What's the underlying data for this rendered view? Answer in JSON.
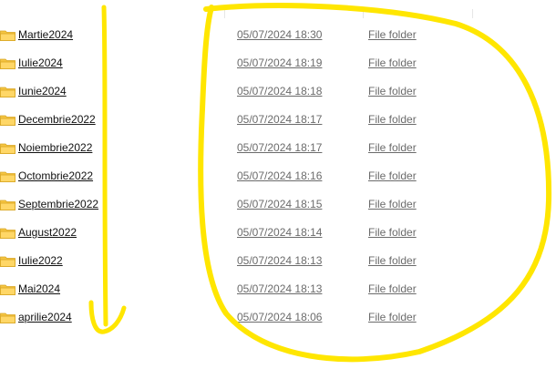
{
  "annotation_color": "#ffe600",
  "folder_color": "#f5c542",
  "rows": [
    {
      "name": "Martie2024",
      "date": "05/07/2024 18:30",
      "type": "File folder",
      "icon": "folder-icon"
    },
    {
      "name": "Iulie2024",
      "date": "05/07/2024 18:19",
      "type": "File folder",
      "icon": "folder-icon"
    },
    {
      "name": "Iunie2024",
      "date": "05/07/2024 18:18",
      "type": "File folder",
      "icon": "folder-icon"
    },
    {
      "name": "Decembrie2022",
      "date": "05/07/2024 18:17",
      "type": "File folder",
      "icon": "folder-icon"
    },
    {
      "name": "Noiembrie2022",
      "date": "05/07/2024 18:17",
      "type": "File folder",
      "icon": "folder-icon"
    },
    {
      "name": "Octombrie2022",
      "date": "05/07/2024 18:16",
      "type": "File folder",
      "icon": "folder-icon"
    },
    {
      "name": "Septembrie2022",
      "date": "05/07/2024 18:15",
      "type": "File folder",
      "icon": "folder-icon"
    },
    {
      "name": "August2022",
      "date": "05/07/2024 18:14",
      "type": "File folder",
      "icon": "folder-icon"
    },
    {
      "name": "Iulie2022",
      "date": "05/07/2024 18:13",
      "type": "File folder",
      "icon": "folder-icon"
    },
    {
      "name": "Mai2024",
      "date": "05/07/2024 18:13",
      "type": "File folder",
      "icon": "folder-icon"
    },
    {
      "name": "aprilie2024",
      "date": "05/07/2024 18:06",
      "type": "File folder",
      "icon": "folder-icon"
    }
  ]
}
